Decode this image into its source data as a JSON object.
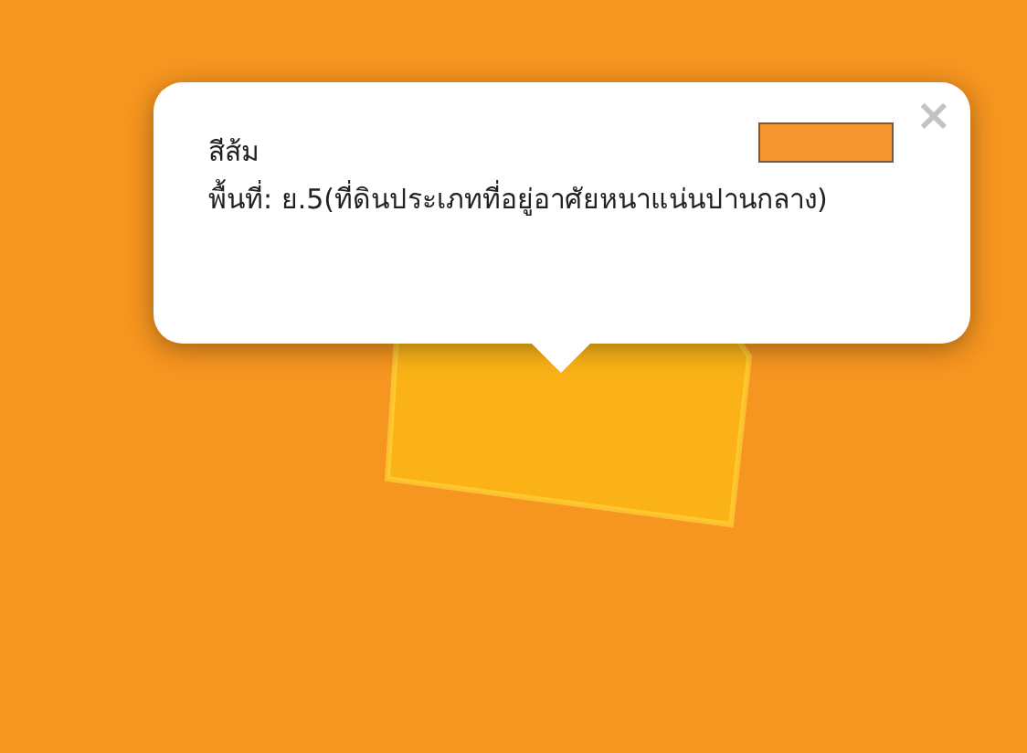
{
  "map": {
    "parcel": {
      "color": "#fbb217"
    }
  },
  "popup": {
    "title": "สีส้ม",
    "swatch": {
      "color": "#f7972f"
    },
    "description": "พื้นที่: ย.5(ที่ดินประเภทที่อยู่อาศัยหนาแน่นปานกลาง)",
    "close": "×"
  }
}
